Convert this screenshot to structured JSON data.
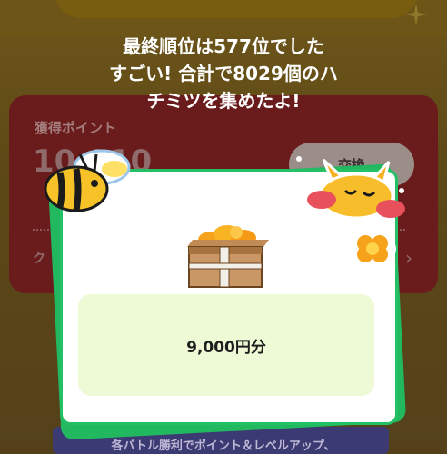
{
  "headline": {
    "line1": "最終順位は577位でした",
    "line2": "すごい! 合計で8029個のハ",
    "line3": "チミツを集めたよ!"
  },
  "background": {
    "panel_label": "獲得ポイント",
    "panel_big_value": "10,910",
    "exchange_label": "交換",
    "panel_small": "ク",
    "bottom_text": "各バトル勝利でポイント＆レベルアップ、"
  },
  "reward": {
    "amount_label": "9,000円分"
  },
  "icons": {
    "treasure": "treasure-chest-icon",
    "bee": "bee-icon",
    "fox": "fox-icon",
    "flower": "flower-icon",
    "sparkle": "sparkle-icon"
  },
  "colors": {
    "modal_border": "#23c066",
    "reward_bg": "#eef9d6",
    "panel_bg": "#6a1c1c"
  }
}
